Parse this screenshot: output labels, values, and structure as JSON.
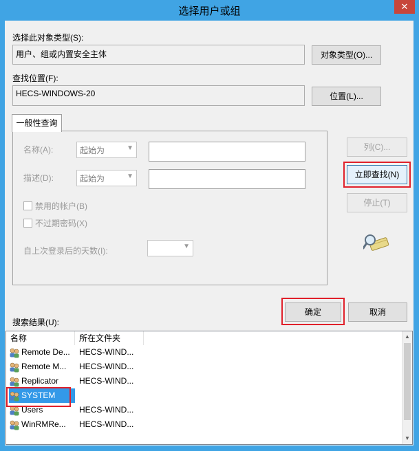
{
  "window": {
    "title": "选择用户或组",
    "close_glyph": "✕"
  },
  "object_type": {
    "label": "选择此对象类型(S):",
    "value": "用户、组或内置安全主体",
    "button": "对象类型(O)..."
  },
  "location": {
    "label": "查找位置(F):",
    "value": "HECS-WINDOWS-20",
    "button": "位置(L)..."
  },
  "tab": {
    "label": "一般性查询"
  },
  "query": {
    "name_label": "名称(A):",
    "name_mode": "起始为",
    "name_value": "",
    "desc_label": "描述(D):",
    "desc_mode": "起始为",
    "desc_value": "",
    "disabled_accounts": "禁用的帐户(B)",
    "no_expire_pwd": "不过期密码(X)",
    "days_label": "自上次登录后的天数(I):",
    "days_value": ""
  },
  "side_buttons": {
    "columns": "列(C)...",
    "find_now": "立即查找(N)",
    "stop": "停止(T)"
  },
  "dialog_buttons": {
    "ok": "确定",
    "cancel": "取消"
  },
  "results": {
    "label": "搜索结果(U):",
    "columns": [
      "名称",
      "所在文件夹"
    ],
    "rows": [
      {
        "name": "Remote De...",
        "folder": "HECS-WIND...",
        "selected": false
      },
      {
        "name": "Remote M...",
        "folder": "HECS-WIND...",
        "selected": false
      },
      {
        "name": "Replicator",
        "folder": "HECS-WIND...",
        "selected": false
      },
      {
        "name": "SYSTEM",
        "folder": "",
        "selected": true
      },
      {
        "name": "Users",
        "folder": "HECS-WIND...",
        "selected": false
      },
      {
        "name": "WinRMRe...",
        "folder": "HECS-WIND...",
        "selected": false
      }
    ]
  },
  "icons": {
    "close": "close-icon",
    "search": "magnifier-search-icon",
    "user_group": "user-group-icon",
    "dropdown": "chevron-down-icon"
  },
  "colors": {
    "title_bar": "#40a4e4",
    "selection": "#3399e8",
    "highlight": "#e0202a"
  }
}
